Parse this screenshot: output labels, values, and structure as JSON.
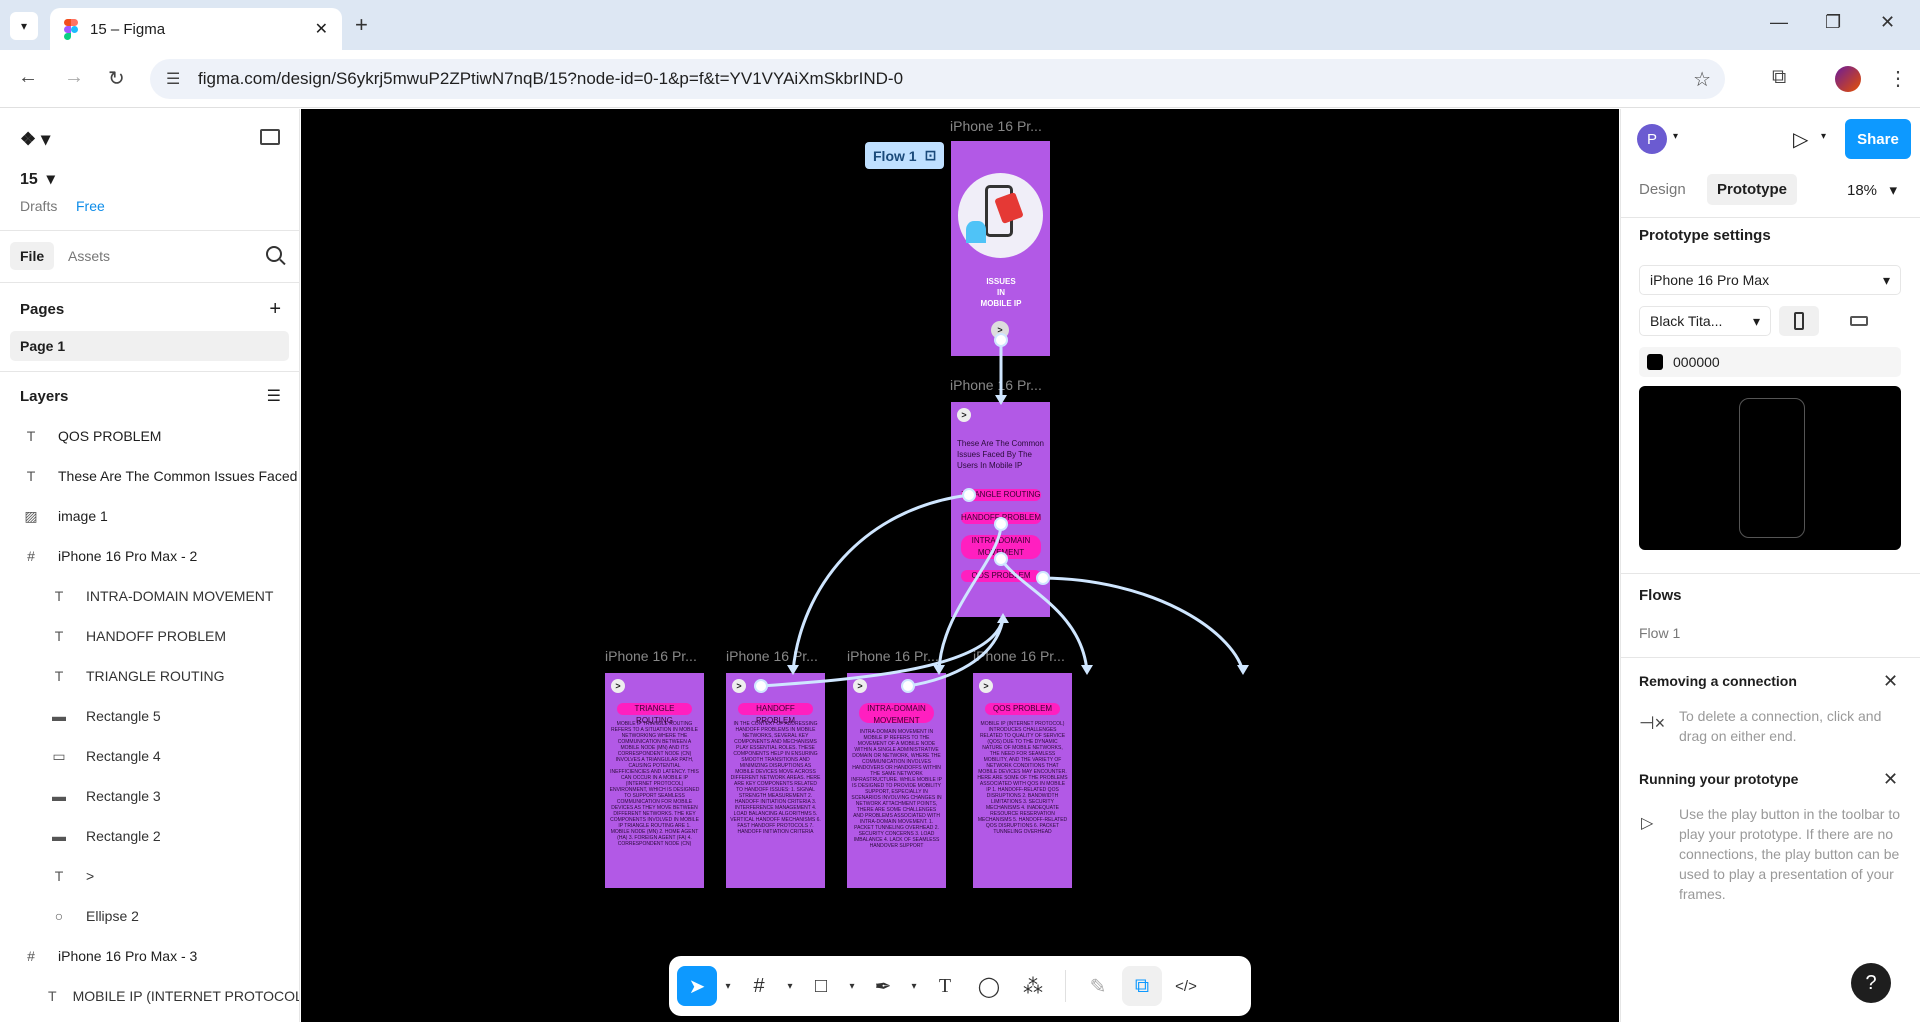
{
  "browser": {
    "tab_title": "15 – Figma",
    "url": "figma.com/design/S6ykrj5mwuP2ZPtiwN7nqB/15?node-id=0-1&p=f&t=YV1VYAiXmSkbrIND-0",
    "icons": [
      "chevron-down-icon",
      "close-icon",
      "plus-icon",
      "back-icon",
      "forward-icon",
      "reload-icon",
      "tune-icon",
      "star-icon",
      "extensions-icon",
      "minimize-icon",
      "restore-icon",
      "close-window-icon"
    ]
  },
  "left_panel": {
    "file_name": "15",
    "drafts": "Drafts",
    "plan": "Free",
    "tab_file": "File",
    "tab_assets": "Assets",
    "pages_heading": "Pages",
    "pages": [
      "Page 1"
    ],
    "layers_heading": "Layers",
    "layers": [
      {
        "icon": "T",
        "label": "QOS PROBLEM",
        "indent": 0
      },
      {
        "icon": "T",
        "label": "These Are The Common Issues Faced",
        "indent": 0
      },
      {
        "icon": "▨",
        "label": "image 1",
        "indent": 0
      },
      {
        "icon": "#",
        "label": "iPhone 16 Pro Max - 2",
        "indent": 0
      },
      {
        "icon": "T",
        "label": "INTRA-DOMAIN MOVEMENT",
        "indent": 1
      },
      {
        "icon": "T",
        "label": "HANDOFF PROBLEM",
        "indent": 1
      },
      {
        "icon": "T",
        "label": "TRIANGLE ROUTING",
        "indent": 1
      },
      {
        "icon": "▬",
        "label": "Rectangle 5",
        "indent": 1
      },
      {
        "icon": "▭",
        "label": "Rectangle 4",
        "indent": 1
      },
      {
        "icon": "▬",
        "label": "Rectangle 3",
        "indent": 1
      },
      {
        "icon": "▬",
        "label": "Rectangle 2",
        "indent": 1
      },
      {
        "icon": "T",
        "label": ">",
        "indent": 1
      },
      {
        "icon": "○",
        "label": "Ellipse 2",
        "indent": 1
      },
      {
        "icon": "#",
        "label": "iPhone 16 Pro Max - 3",
        "indent": 0
      },
      {
        "icon": "T",
        "label": "MOBILE IP (INTERNET PROTOCOL",
        "indent": 1
      }
    ]
  },
  "canvas": {
    "background": "#000000",
    "frame_color": "#b259e6",
    "pill_color": "#ff1fc0",
    "connector_color": "#cfe6ff",
    "flow_tag": "Flow 1",
    "frame_label": "iPhone 16 Pr...",
    "frame1_title": "ISSUES\nIN\nMOBILE IP",
    "frame2_text": "These Are The Common Issues Faced By The Users In Mobile IP",
    "frame2_pills": [
      "TRIANGLE ROUTING",
      "HANDOFF PROBLEM",
      "INTRA-DOMAIN MOVEMENT",
      "QOS PROBLEM"
    ],
    "arrow_glyph": ">",
    "detail_frames": [
      {
        "title": "TRIANGLE ROUTING",
        "body": "MOBILE IP TRIANGLE ROUTING REFERS TO A SITUATION IN MOBILE NETWORKING WHERE THE COMMUNICATION BETWEEN A MOBILE NODE (MN) AND ITS CORRESPONDENT NODE (CN) INVOLVES A TRIANGULAR PATH, CAUSING POTENTIAL INEFFICIENCIES AND LATENCY. THIS CAN OCCUR IN A MOBILE IP (INTERNET PROTOCOL) ENVIRONMENT, WHICH IS DESIGNED TO SUPPORT SEAMLESS COMMUNICATION FOR MOBILE DEVICES AS THEY MOVE BETWEEN DIFFERENT NETWORKS. THE KEY COMPONENTS INVOLVED IN MOBILE IP TRIANGLE ROUTING ARE 1. MOBILE NODE (MN) 2. HOME AGENT (HA) 3. FOREIGN AGENT (FA) 4. CORRESPONDENT NODE (CN)"
      },
      {
        "title": "HANDOFF PROBLEM",
        "body": "IN THE CONTEXT OF ADDRESSING HANDOFF PROBLEMS IN MOBILE NETWORKS, SEVERAL KEY COMPONENTS AND MECHANISMS PLAY ESSENTIAL ROLES. THESE COMPONENTS HELP IN ENSURING SMOOTH TRANSITIONS AND MINIMIZING DISRUPTIONS AS MOBILE DEVICES MOVE ACROSS DIFFERENT NETWORK AREAS. HERE ARE KEY COMPONENTS RELATED TO HANDOFF ISSUES: 1. SIGNAL STRENGTH MEASUREMENT 2. HANDOFF INITIATION CRITERIA 3. INTERFERENCE MANAGEMENT 4. LOAD BALANCING ALGORITHMS 5. VERTICAL HANDOFF MECHANISMS 6. FAST HANDOFF PROTOCOLS 7. HANDOFF INITIATION CRITERIA"
      },
      {
        "title": "INTRA-DOMAIN MOVEMENT",
        "body": "INTRA-DOMAIN MOVEMENT IN MOBILE IP REFERS TO THE MOVEMENT OF A MOBILE NODE WITHIN A SINGLE ADMINISTRATIVE DOMAIN OR NETWORK, WHERE THE COMMUNICATION INVOLVES HANDOVERS OR HANDOFFS WITHIN THE SAME NETWORK INFRASTRUCTURE. WHILE MOBILE IP IS DESIGNED TO PROVIDE MOBILITY SUPPORT, ESPECIALLY IN SCENARIOS INVOLVING CHANGES IN NETWORK ATTACHMENT POINTS, THERE ARE SOME CHALLENGES AND PROBLEMS ASSOCIATED WITH INTRA-DOMAIN MOVEMENT. 1. PACKET TUNNELING OVERHEAD 2. SECURITY CONCERNS 3. LOAD IMBALANCE 4. LACK OF SEAMLESS HANDOVER SUPPORT"
      },
      {
        "title": "QOS PROBLEM",
        "body": "MOBILE IP (INTERNET PROTOCOL) INTRODUCES CHALLENGES RELATED TO QUALITY OF SERVICE (QOS) DUE TO THE DYNAMIC NATURE OF MOBILE NETWORKS, THE NEED FOR SEAMLESS MOBILITY, AND THE VARIETY OF NETWORK CONDITIONS THAT MOBILE DEVICES MAY ENCOUNTER. HERE ARE SOME OF THE PROBLEMS ASSOCIATED WITH QOS IN MOBILE IP 1. HANDOFF-RELATED QOS DISRUPTIONS 2. BANDWIDTH LIMITATIONS 3. SECURITY MECHANISMS 4. INADEQUATE RESOURCE RESERVATION MECHANISMS 5. HANDOFF-RELATED QOS DISRUPTIONS 6. PACKET TUNNELING OVERHEAD"
      }
    ]
  },
  "toolbar": {
    "tools": [
      "move-icon",
      "frame-icon",
      "rectangle-icon",
      "pen-icon",
      "text-icon",
      "comment-icon",
      "actions-icon",
      "draw-icon",
      "prototype-icon",
      "dev-mode-icon"
    ]
  },
  "right_panel": {
    "avatar_letter": "P",
    "share": "Share",
    "tab_design": "Design",
    "tab_prototype": "Prototype",
    "zoom": "18%",
    "prototype_settings": "Prototype settings",
    "device": "iPhone 16 Pro Max",
    "model_color": "Black Tita...",
    "bg_color": "000000",
    "flows_heading": "Flows",
    "flows": [
      "Flow 1"
    ],
    "removing_heading": "Removing a connection",
    "removing_hint": "To delete a connection, click and drag on either end.",
    "running_heading": "Running your prototype",
    "running_hint": "Use the play button in the toolbar to play your prototype. If there are no connections, the play button can be used to play a presentation of your frames.",
    "help": "?"
  }
}
